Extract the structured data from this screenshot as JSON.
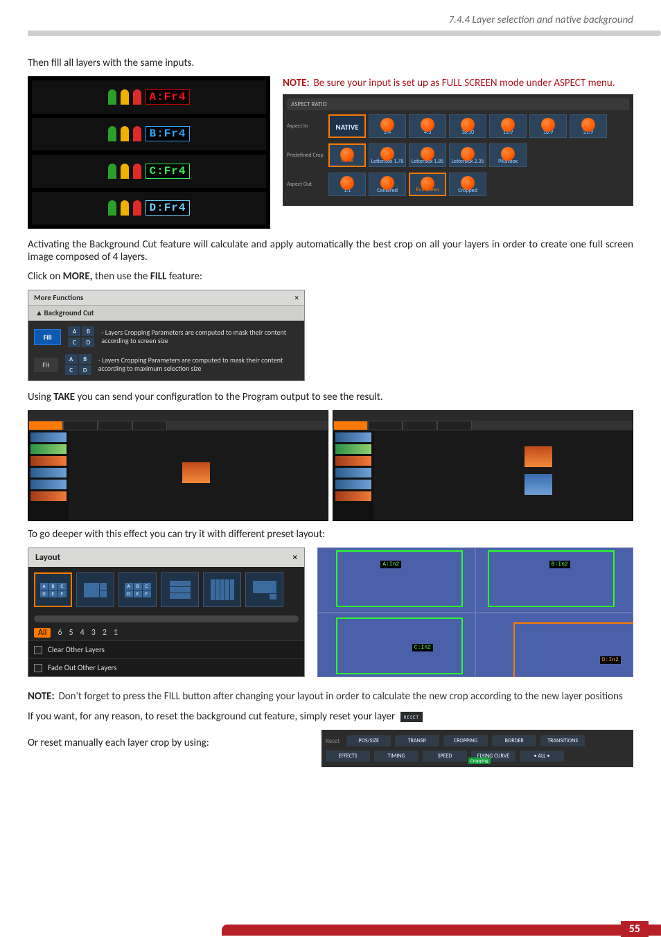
{
  "header": {
    "section": "7.4.4 Layer selection and native background"
  },
  "p_intro": "Then fill all layers with the same inputs.",
  "layers": [
    {
      "tag": "A:Fr4"
    },
    {
      "tag": "B:Fr4"
    },
    {
      "tag": "C:Fr4"
    },
    {
      "tag": "D:Fr4"
    }
  ],
  "note1": {
    "label": "NOTE:",
    "text": "Be sure your input is set up as FULL SCREEN mode under ASPECT menu."
  },
  "aspect": {
    "title": "ASPECT RATIO",
    "in_label": "Aspect In",
    "in": [
      "NATIVE",
      "5:4",
      "4:3",
      "16:10",
      "15:9",
      "16:9",
      "21:9"
    ],
    "crop_label": "Predefined Crop",
    "crop": [
      "None",
      "Letterbox 1.78",
      "Letterbox 1.85",
      "Letterbox 2.35",
      "Pillarbox"
    ],
    "out_label": "Aspect Out",
    "out": [
      "1:1",
      "Centered",
      "Fullscreen",
      "Cropped"
    ]
  },
  "p_bgcut": "Activating the Background Cut feature will calculate and apply automatically the best crop on all your layers in order to create one full screen image composed of 4 layers.",
  "p_more_pre": "Click on ",
  "p_more_bold": "MORE,",
  "p_more_mid": " then use the ",
  "p_more_bold2": "FILL",
  "p_more_post": " feature:",
  "mf": {
    "title": "More Functions",
    "section": "Background Cut",
    "fill": "Fill",
    "fit": "Fit",
    "desc_fill": "- Layers Cropping Parameters are computed to mask their content according to screen size",
    "desc_fit": "- Layers Cropping Parameters are computed to mask their content according to maximum selection size",
    "grid": [
      "A",
      "B",
      "C",
      "D"
    ]
  },
  "p_take_pre": "Using ",
  "p_take_bold": "TAKE",
  "p_take_post": " you can send your configuration to the Program output to see the result.",
  "p_deeper": "To go deeper with this effect you can try it with different preset layout:",
  "layout": {
    "title": "Layout",
    "nums_all": "All",
    "nums": [
      "6",
      "5",
      "4",
      "3",
      "2",
      "1"
    ],
    "opt1": "Clear Other Layers",
    "opt2": "Fade Out Other Layers",
    "letters": [
      "A",
      "B",
      "C",
      "D",
      "E",
      "F"
    ],
    "letters2": [
      "A",
      "B",
      "C",
      "D",
      "E",
      "F"
    ],
    "preview_tags": [
      "A:In2",
      "B:In2",
      "C:In2",
      "D:In2"
    ]
  },
  "note2": {
    "label": "NOTE:",
    "text": "Don't forget to press the FILL button after changing your layout in order to calculate the new crop according to the new layer positions"
  },
  "p_reset": "If you want, for any reason, to reset the background cut feature, simply reset your layer",
  "reset_btn": "RESET",
  "p_reset2": "Or reset manually each layer crop by using:",
  "reset_panel": {
    "label": "Reset",
    "row1": [
      "POS/SIZE",
      "TRANSP.",
      "CROPPING",
      "BORDER",
      "TRANSITIONS"
    ],
    "row2": [
      "EFFECTS",
      "TIMING",
      "SPEED",
      "FLYING CURVE",
      "• ALL •"
    ],
    "crop_badge": "Cropping"
  },
  "page_number": "55"
}
